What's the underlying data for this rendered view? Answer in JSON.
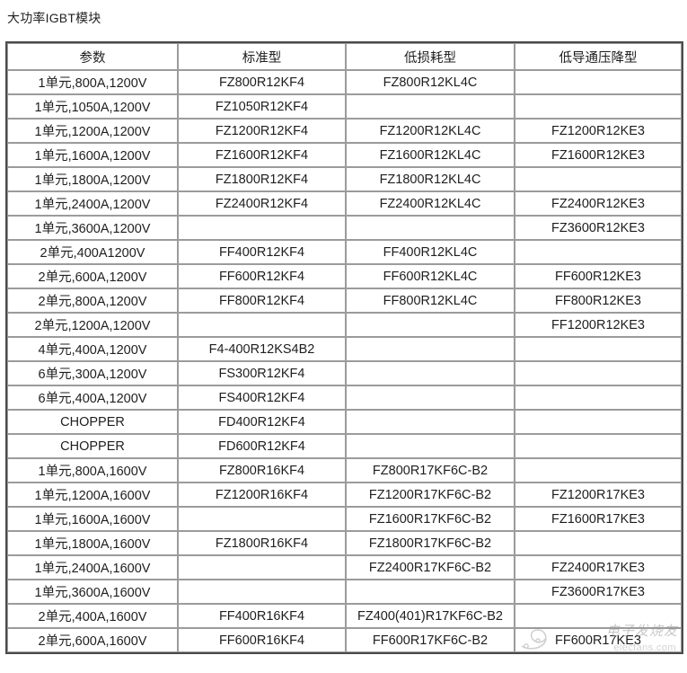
{
  "page": {
    "title": "大功率IGBT模块"
  },
  "table": {
    "columns": [
      "参数",
      "标准型",
      "低损耗型",
      "低导通压降型"
    ],
    "rows": [
      [
        "1单元,800A,1200V",
        "FZ800R12KF4",
        "FZ800R12KL4C",
        ""
      ],
      [
        "1单元,1050A,1200V",
        "FZ1050R12KF4",
        "",
        ""
      ],
      [
        "1单元,1200A,1200V",
        "FZ1200R12KF4",
        "FZ1200R12KL4C",
        "FZ1200R12KE3"
      ],
      [
        "1单元,1600A,1200V",
        "FZ1600R12KF4",
        "FZ1600R12KL4C",
        "FZ1600R12KE3"
      ],
      [
        "1单元,1800A,1200V",
        "FZ1800R12KF4",
        "FZ1800R12KL4C",
        ""
      ],
      [
        "1单元,2400A,1200V",
        "FZ2400R12KF4",
        "FZ2400R12KL4C",
        "FZ2400R12KE3"
      ],
      [
        "1单元,3600A,1200V",
        "",
        "",
        "FZ3600R12KE3"
      ],
      [
        "2单元,400A1200V",
        "FF400R12KF4",
        "FF400R12KL4C",
        ""
      ],
      [
        "2单元,600A,1200V",
        "FF600R12KF4",
        "FF600R12KL4C",
        "FF600R12KE3"
      ],
      [
        "2单元,800A,1200V",
        "FF800R12KF4",
        "FF800R12KL4C",
        "FF800R12KE3"
      ],
      [
        "2单元,1200A,1200V",
        "",
        "",
        "FF1200R12KE3"
      ],
      [
        "4单元,400A,1200V",
        "F4-400R12KS4B2",
        "",
        ""
      ],
      [
        "6单元,300A,1200V",
        "FS300R12KF4",
        "",
        ""
      ],
      [
        "6单元,400A,1200V",
        "FS400R12KF4",
        "",
        ""
      ],
      [
        "CHOPPER",
        "FD400R12KF4",
        "",
        ""
      ],
      [
        "CHOPPER",
        "FD600R12KF4",
        "",
        ""
      ],
      [
        "1单元,800A,1600V",
        "FZ800R16KF4",
        "FZ800R17KF6C-B2",
        ""
      ],
      [
        "1单元,1200A,1600V",
        "FZ1200R16KF4",
        "FZ1200R17KF6C-B2",
        "FZ1200R17KE3"
      ],
      [
        "1单元,1600A,1600V",
        "",
        "FZ1600R17KF6C-B2",
        "FZ1600R17KE3"
      ],
      [
        "1单元,1800A,1600V",
        "FZ1800R16KF4",
        "FZ1800R17KF6C-B2",
        ""
      ],
      [
        "1单元,2400A,1600V",
        "",
        "FZ2400R17KF6C-B2",
        "FZ2400R17KE3"
      ],
      [
        "1单元,3600A,1600V",
        "",
        "",
        "FZ3600R17KE3"
      ],
      [
        "2单元,400A,1600V",
        "FF400R16KF4",
        "FZ400(401)R17KF6C-B2",
        ""
      ],
      [
        "2单元,600A,1600V",
        "FF600R16KF4",
        "FF600R17KF6C-B2",
        "FF600R17KE3"
      ]
    ]
  },
  "watermark": {
    "cn_text": "电子发烧友",
    "en_text": "elecfans.com"
  }
}
